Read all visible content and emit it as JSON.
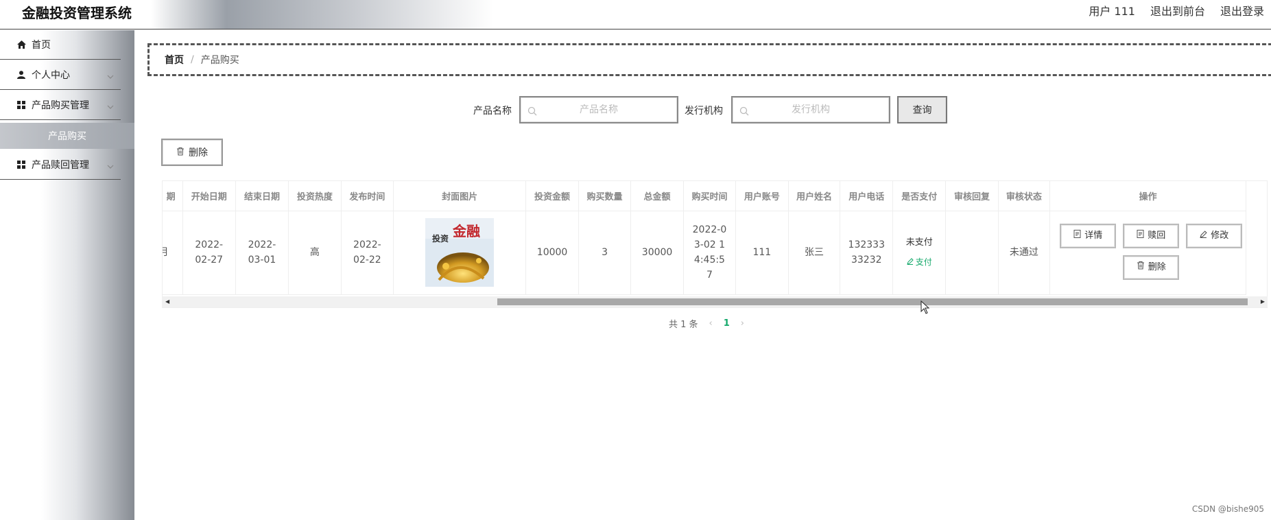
{
  "app": {
    "title": "金融投资管理系统",
    "links": {
      "user": "用户 111",
      "front": "退出到前台",
      "logout": "退出登录"
    }
  },
  "sidebar": {
    "items": [
      {
        "label": "首页",
        "icon": "home-icon"
      },
      {
        "label": "个人中心",
        "icon": "user-icon"
      },
      {
        "label": "产品购买管理",
        "icon": "grid-icon"
      },
      {
        "label": "产品赎回管理",
        "icon": "grid-icon"
      }
    ],
    "submenu_active": "产品购买"
  },
  "breadcrumb": {
    "home": "首页",
    "separator": "/",
    "current": "产品购买"
  },
  "search": {
    "name_label": "产品名称",
    "name_placeholder": "产品名称",
    "org_label": "发行机构",
    "org_placeholder": "发行机构",
    "query_button": "查询"
  },
  "toolbar": {
    "delete_button": "删除"
  },
  "table": {
    "headers": [
      "期",
      "开始日期",
      "结束日期",
      "投资热度",
      "发布时间",
      "封面图片",
      "投资金额",
      "购买数量",
      "总金额",
      "购买时间",
      "用户账号",
      "用户姓名",
      "用户电话",
      "是否支付",
      "审核回复",
      "审核状态",
      "操作"
    ],
    "rows": [
      {
        "period": "月",
        "start_date": "2022-02-27",
        "end_date": "2022-03-01",
        "heat": "高",
        "publish_time": "2022-02-22",
        "cover_text_1": "投资",
        "cover_text_2": "金融",
        "amount": "10000",
        "quantity": "3",
        "total": "30000",
        "purchase_time": "2022-03-02 14:45:57",
        "account": "111",
        "name": "张三",
        "phone": "13233333232",
        "pay_status": "未支付",
        "pay_link": "支付",
        "review_reply": "",
        "review_status": "未通过",
        "ops": {
          "detail": "详情",
          "redeem": "赎回",
          "edit": "修改",
          "delete": "删除"
        }
      }
    ]
  },
  "pagination": {
    "total": "共 1 条",
    "current_page": "1"
  },
  "watermark": "CSDN @bishe905",
  "colors": {
    "accent": "#13a86a",
    "header_gray": "#9aa0a8"
  }
}
